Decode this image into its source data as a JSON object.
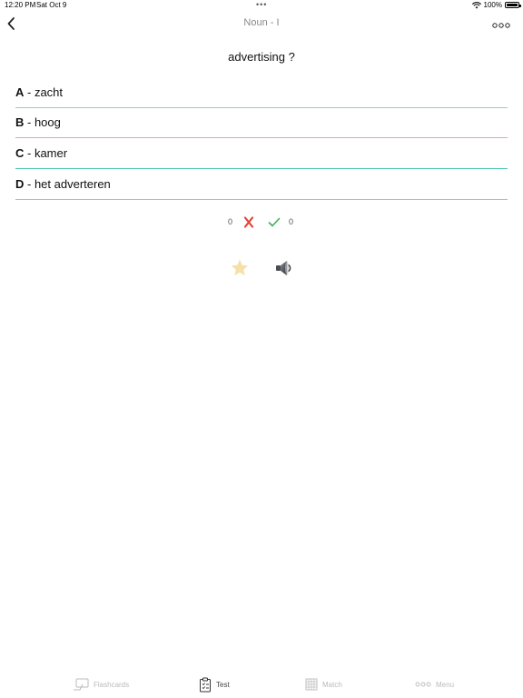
{
  "status_bar": {
    "time": "12:20 PM",
    "date": "Sat Oct 9",
    "dots": "•••",
    "battery": "100%",
    "wifi_icon": "wifi-icon",
    "battery_icon": "battery-icon"
  },
  "nav": {
    "title": "Noun - I",
    "back_icon": "chevron-left-icon",
    "more_icon": "more-icon"
  },
  "question": {
    "text": "advertising ?"
  },
  "options": [
    {
      "letter": "A",
      "sep": " - ",
      "text": "zacht",
      "line_color": "#7fd6dc"
    },
    {
      "letter": "B",
      "sep": " - ",
      "text": "hoog",
      "line_color": "#f0a0a8"
    },
    {
      "letter": "C",
      "sep": " - ",
      "text": "kamer",
      "line_color": "#4fc7a8"
    },
    {
      "letter": "D",
      "sep": " - ",
      "text": "het adverteren",
      "line_color": "#f0a0a8"
    }
  ],
  "score": {
    "wrong_count": "0",
    "correct_count": "0",
    "wrong_color": "#e0463c",
    "correct_color": "#3fb05a"
  },
  "actions": {
    "star_icon": "star-icon",
    "star_color": "#f6dfa8",
    "speaker_icon": "speaker-icon"
  },
  "tabs": [
    {
      "label": "Flashcards",
      "icon": "flashcards-icon",
      "active": false
    },
    {
      "label": "Test",
      "icon": "test-clipboard-icon",
      "active": true
    },
    {
      "label": "Match",
      "icon": "grid-icon",
      "active": false
    },
    {
      "label": "Menu",
      "icon": "more-icon",
      "active": false
    }
  ]
}
